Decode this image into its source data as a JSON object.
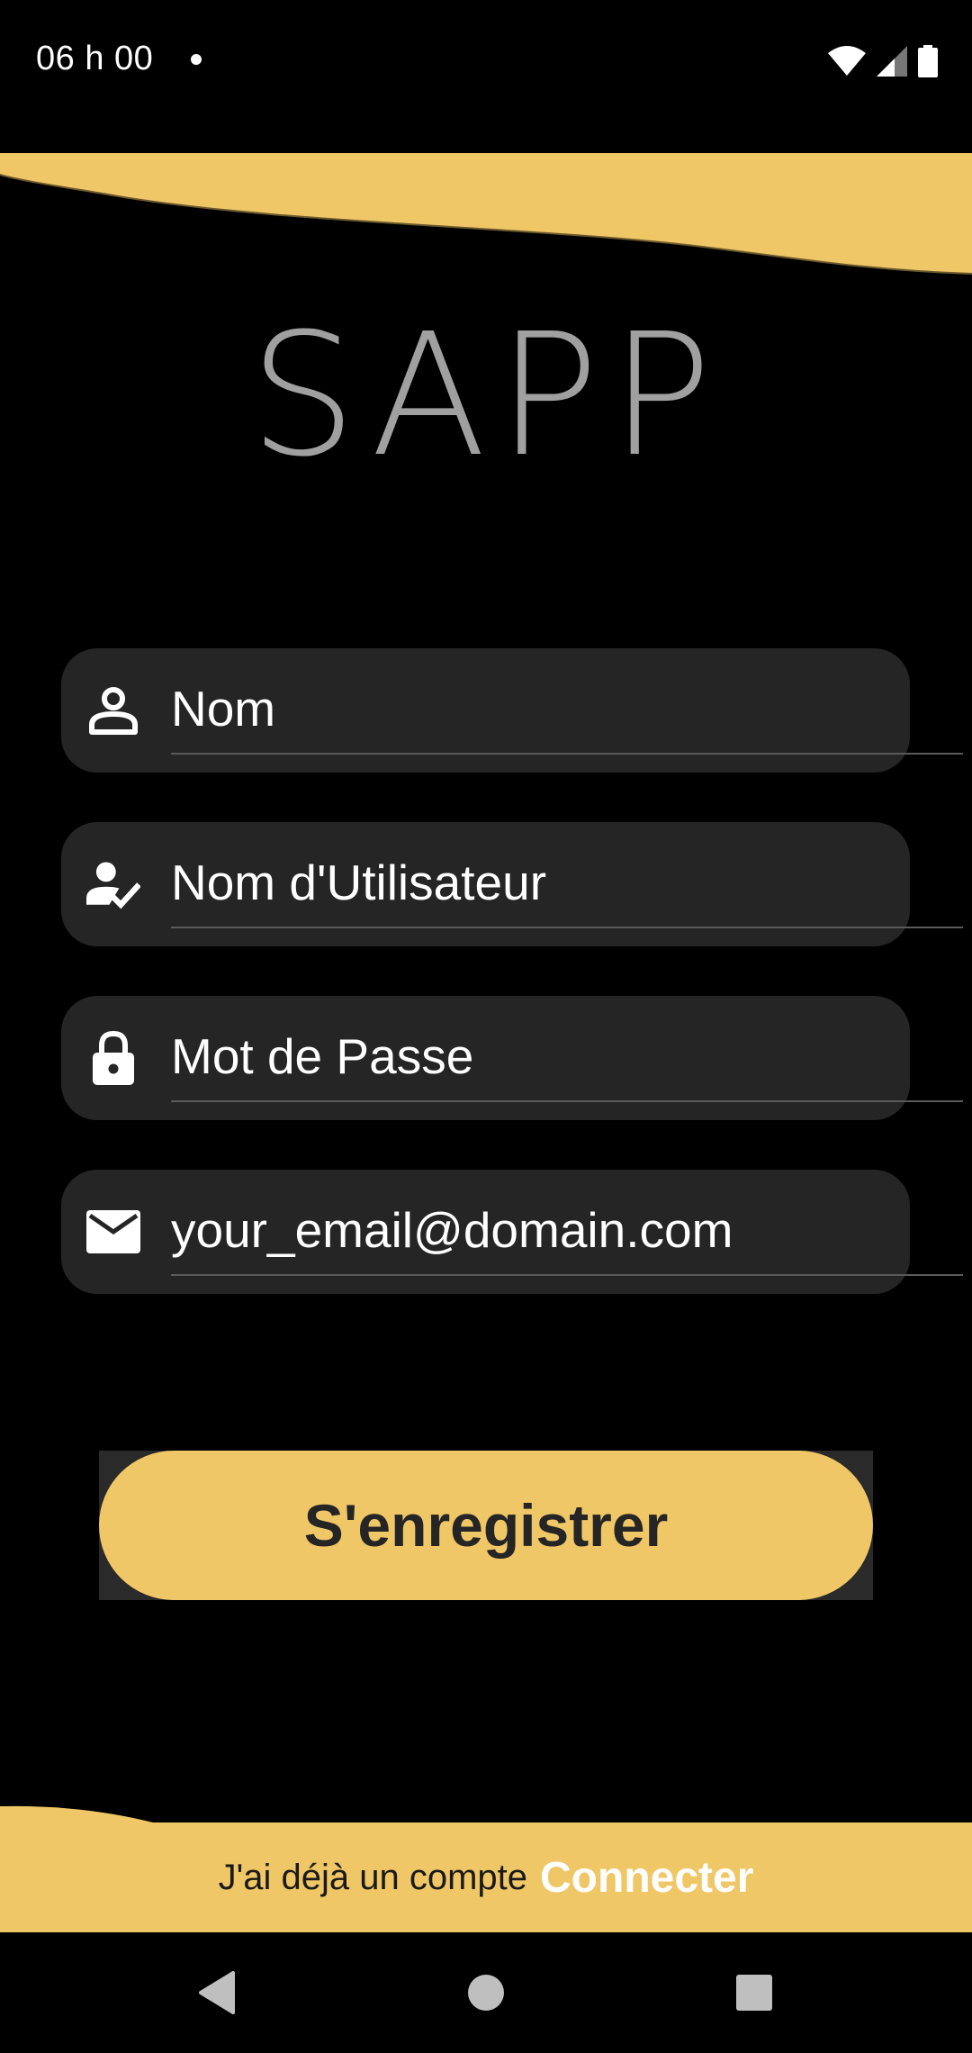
{
  "status_bar": {
    "time": "06 h 00"
  },
  "app": {
    "logo": "SAPP"
  },
  "form": {
    "fields": [
      {
        "placeholder": "Nom",
        "icon": "person-icon"
      },
      {
        "placeholder": "Nom d'Utilisateur",
        "icon": "user-check-icon"
      },
      {
        "placeholder": "Mot de Passe",
        "icon": "lock-icon"
      },
      {
        "placeholder": "your_email@domain.com",
        "icon": "email-icon"
      }
    ],
    "register_label": "S'enregistrer"
  },
  "footer": {
    "prompt": "J'ai déjà un compte",
    "login_label": "Connecter"
  },
  "colors": {
    "accent": "#f0c766",
    "background": "#000000",
    "field_bg": "#252525",
    "logo": "#a0a0a0"
  },
  "nav": {
    "back_icon": "back-triangle-icon",
    "home_icon": "home-circle-icon",
    "recents_icon": "recents-square-icon"
  }
}
